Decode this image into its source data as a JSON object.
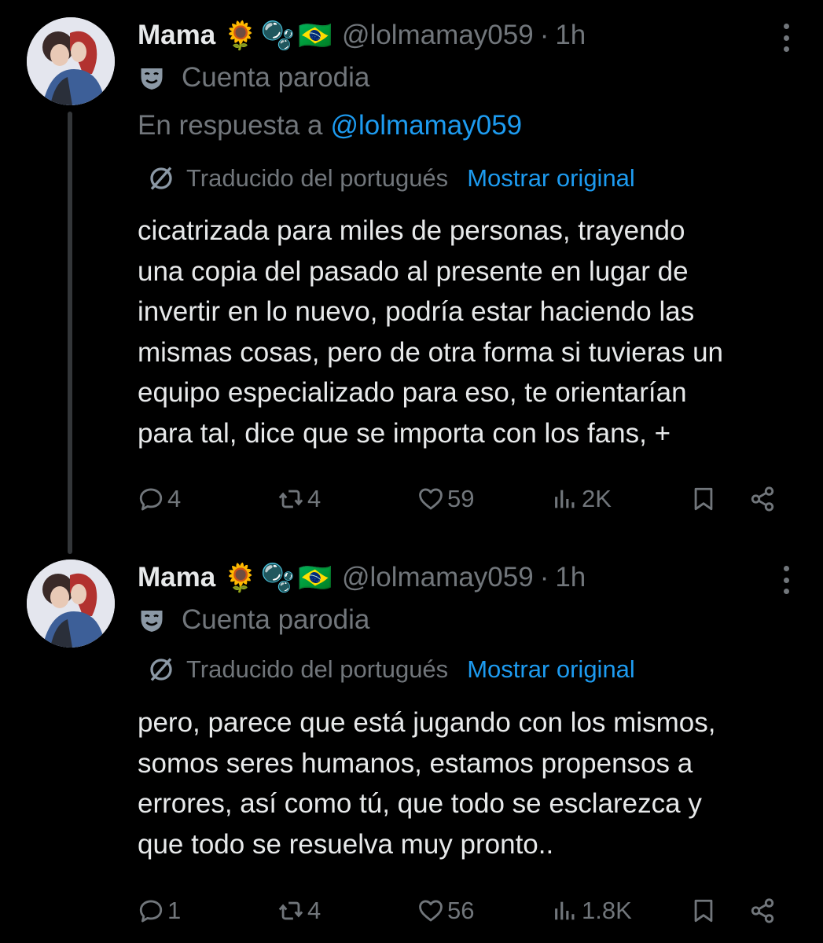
{
  "tweets": [
    {
      "author": {
        "display_name": "Mama",
        "emojis": [
          "🌻",
          "🫧",
          "🇧🇷"
        ],
        "handle": "@lolmamay059",
        "time": "1h"
      },
      "parody_label": "Cuenta parodia",
      "reply_prefix": "En respuesta a",
      "reply_to": "@lolmamay059",
      "translated_label": "Traducido del portugués",
      "show_original": "Mostrar original",
      "text_lines": [
        "cicatrizada para miles de personas, trayendo",
        "una copia del pasado al presente en lugar de",
        "invertir en lo nuevo, podría estar haciendo las",
        "mismas cosas, pero de otra forma si tuvieras un",
        "equipo especializado para eso, te orientarían",
        "para tal, dice que se importa con los fans, +"
      ],
      "stats": {
        "replies": "4",
        "reposts": "4",
        "likes": "59",
        "views": "2K"
      },
      "icons": [
        "reply-icon",
        "repost-icon",
        "like-icon",
        "views-icon",
        "bookmark-icon",
        "share-icon"
      ]
    },
    {
      "author": {
        "display_name": "Mama",
        "emojis": [
          "🌻",
          "🫧",
          "🇧🇷"
        ],
        "handle": "@lolmamay059",
        "time": "1h"
      },
      "parody_label": "Cuenta parodia",
      "translated_label": "Traducido del portugués",
      "show_original": "Mostrar original",
      "text_lines": [
        "pero, parece que está jugando con los mismos,",
        "somos seres humanos, estamos propensos a",
        "errores, así como tú, que todo se esclarezca y",
        "que todo se resuelva muy pronto.."
      ],
      "stats": {
        "replies": "1",
        "reposts": "4",
        "likes": "56",
        "views": "1.8K"
      },
      "icons": [
        "reply-icon",
        "repost-icon",
        "like-icon",
        "views-icon",
        "bookmark-icon",
        "share-icon"
      ]
    }
  ],
  "colors": {
    "background": "#000000",
    "text": "#e7e9ea",
    "secondary": "#71767b",
    "link": "#1d9bf0"
  }
}
